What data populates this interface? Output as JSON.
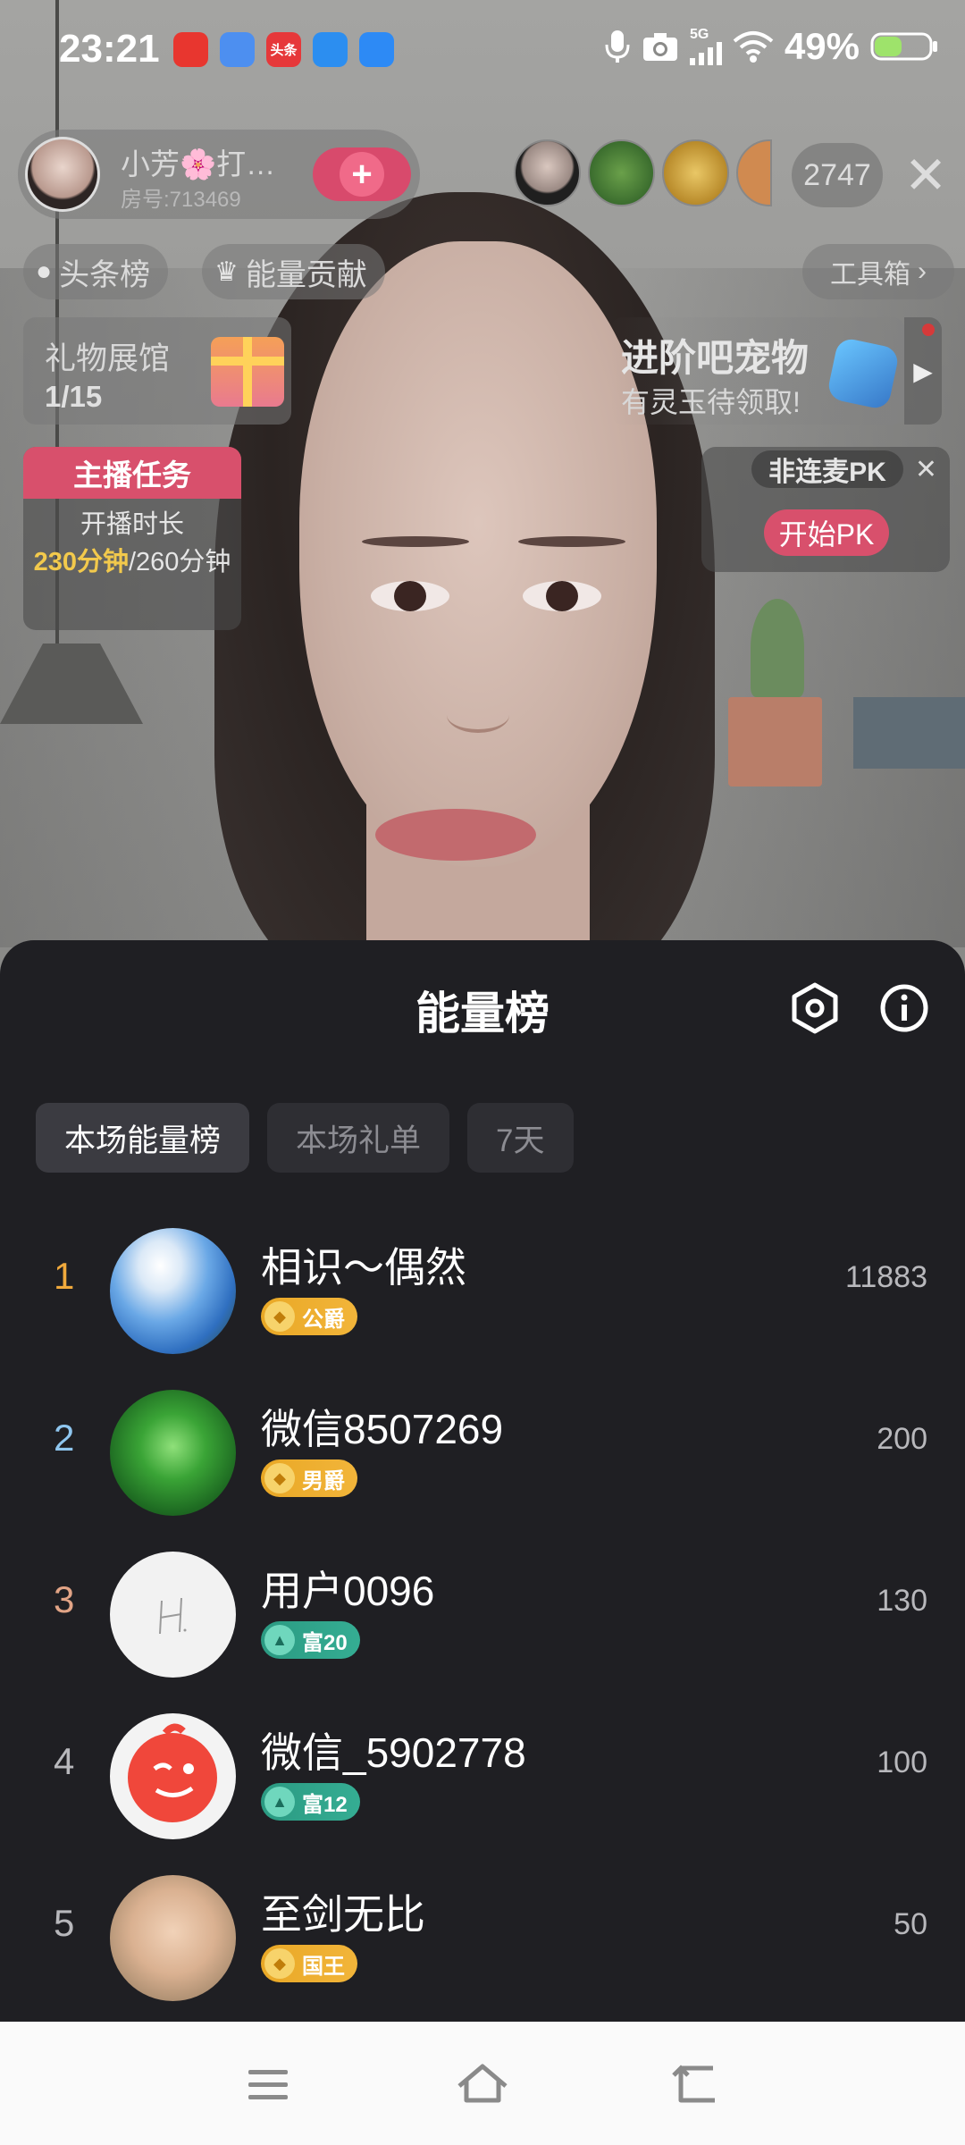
{
  "status_bar": {
    "time": "23:21",
    "app_icons": [
      {
        "name": "huawei-appgallery-icon",
        "label": "",
        "color": "#e8362f"
      },
      {
        "name": "music-app-icon",
        "label": "",
        "color": "#4d8ff0"
      },
      {
        "name": "toutiao-icon",
        "label": "头条",
        "color": "#e6383a"
      },
      {
        "name": "weather-icon",
        "label": "",
        "color": "#2c8ef0"
      },
      {
        "name": "browser-icon",
        "label": "",
        "color": "#2d8af5"
      }
    ],
    "network": "5G",
    "battery": "49%"
  },
  "live": {
    "host_name": "小芳🌸打…",
    "room_number": "房号:713469",
    "viewer_count": "2747",
    "chips": {
      "headline_rank": "头条榜",
      "energy_contrib": "能量贡献"
    },
    "toolbox": "工具箱",
    "gift_gallery": {
      "title": "礼物展馆",
      "count": "1/15"
    },
    "pet_banner": {
      "title": "进阶吧宠物",
      "subtitle": "有灵玉待领取!"
    },
    "anchor_task": {
      "title": "主播任务",
      "line1": "开播时长",
      "progress": "230分钟",
      "total": "/260分钟",
      "progress_fraction": 0.885
    },
    "pk": {
      "label": "非连麦PK",
      "button": "开始PK"
    }
  },
  "sheet": {
    "title": "能量榜",
    "tabs": [
      {
        "label": "本场能量榜",
        "active": true
      },
      {
        "label": "本场礼单",
        "active": false
      },
      {
        "label": "7天",
        "active": false
      }
    ],
    "rows": [
      {
        "rank": "1",
        "rank_color": "#f0a93c",
        "name": "相识～偶然",
        "badge": "公爵",
        "badge_type": "gold",
        "score": "11883"
      },
      {
        "rank": "2",
        "rank_color": "#8fc6ef",
        "name": "微信8507269",
        "badge": "男爵",
        "badge_type": "gold",
        "score": "200"
      },
      {
        "rank": "3",
        "rank_color": "#e2a486",
        "name": "用户0096",
        "badge": "富20",
        "badge_type": "green",
        "score": "130"
      },
      {
        "rank": "4",
        "rank_color": "#b8b8bc",
        "name": "微信_5902778",
        "badge": "富12",
        "badge_type": "green",
        "score": "100"
      },
      {
        "rank": "5",
        "rank_color": "#b8b8bc",
        "name": "至剑无比",
        "badge": "国王",
        "badge_type": "gold",
        "score": "50"
      }
    ]
  },
  "nav": {
    "menu": "menu-icon",
    "home": "home-icon",
    "back": "back-icon"
  }
}
